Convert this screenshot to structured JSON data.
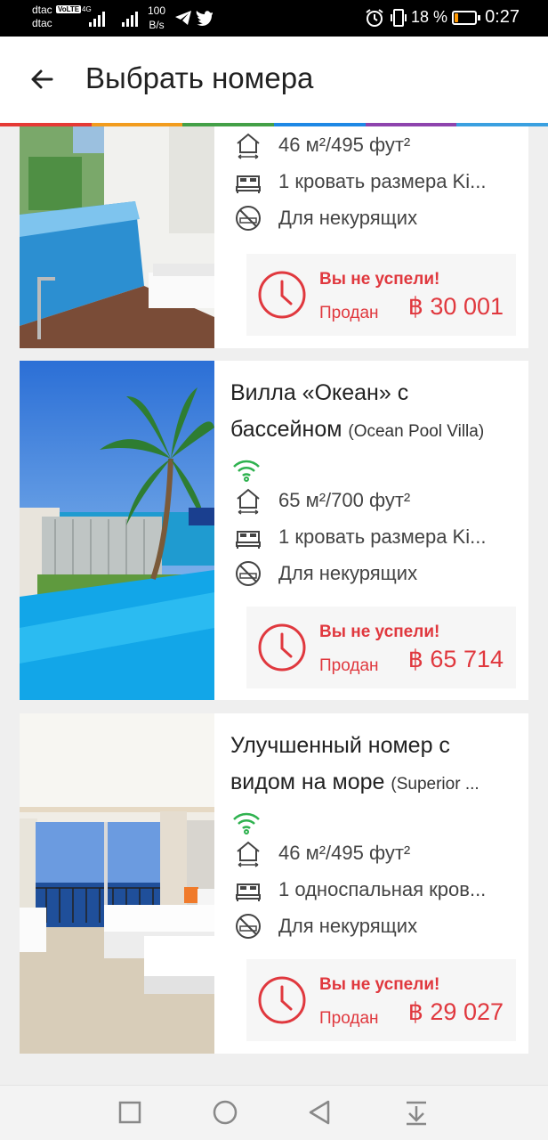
{
  "status_bar": {
    "carrier_1": "dtac",
    "carrier_2": "dtac",
    "volte": "VoLTE",
    "network": "4G",
    "speed_value": "100",
    "speed_unit": "B/s",
    "battery_pct": "18 %",
    "battery_level": 0.18,
    "time": "0:27"
  },
  "header": {
    "title": "Выбрать номера"
  },
  "accent_colors": [
    "#e53935",
    "#f29c1e",
    "#43a047",
    "#1e88e5",
    "#8e44ad",
    "#3aa0e0"
  ],
  "rooms": [
    {
      "name": "",
      "area": "46 м²/495 фут²",
      "bed": "1 кровать размера Ki...",
      "smoking": "Для некурящих",
      "sold_title": "Вы не успели!",
      "sold_label": "Продан",
      "price": "฿ 30 001"
    },
    {
      "name": "Вилла «Океан» с бассейном",
      "name_en": "(Ocean Pool Villa)",
      "area": "65 м²/700 фут²",
      "bed": "1 кровать размера Ki...",
      "smoking": "Для некурящих",
      "sold_title": "Вы не успели!",
      "sold_label": "Продан",
      "price": "฿ 65 714"
    },
    {
      "name": "Улучшенный номер с видом на море",
      "name_en": "(Superior ...",
      "area": "46 м²/495 фут²",
      "bed": "1 односпальная кров...",
      "smoking": "Для некурящих",
      "sold_title": "Вы не успели!",
      "sold_label": "Продан",
      "price": "฿ 29 027"
    }
  ],
  "icons": {
    "back": "arrow-left-icon",
    "area": "house-area-icon",
    "bed": "bed-icon",
    "no_smoking": "no-smoking-icon",
    "wifi": "wifi-icon",
    "clock": "clock-icon",
    "nav": [
      "square-icon",
      "circle-icon",
      "triangle-back-icon",
      "notification-down-icon"
    ]
  }
}
